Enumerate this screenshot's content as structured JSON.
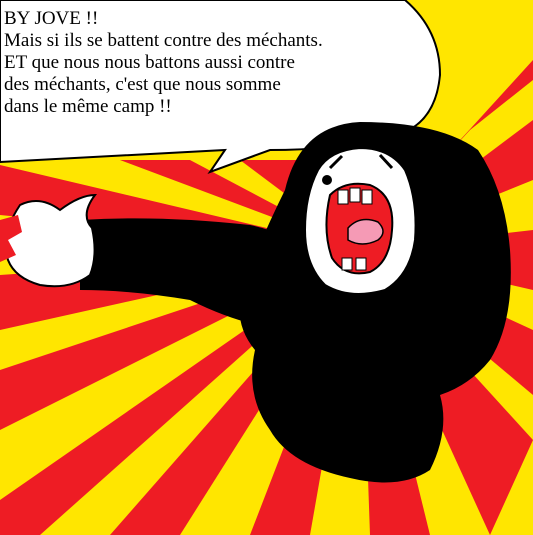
{
  "colors": {
    "background": "#ffe600",
    "rays": "#ee1c24",
    "figure": "#000000",
    "bubble": "#ffffff",
    "tongue": "#f59ab5",
    "skin": "#ffffff"
  },
  "speech": {
    "lines": [
      "BY JOVE !!",
      "Mais si ils se battent contre des méchants.",
      "ET que nous nous battons aussi contre",
      "des méchants, c'est que nous somme",
      "dans le même camp !!"
    ]
  }
}
